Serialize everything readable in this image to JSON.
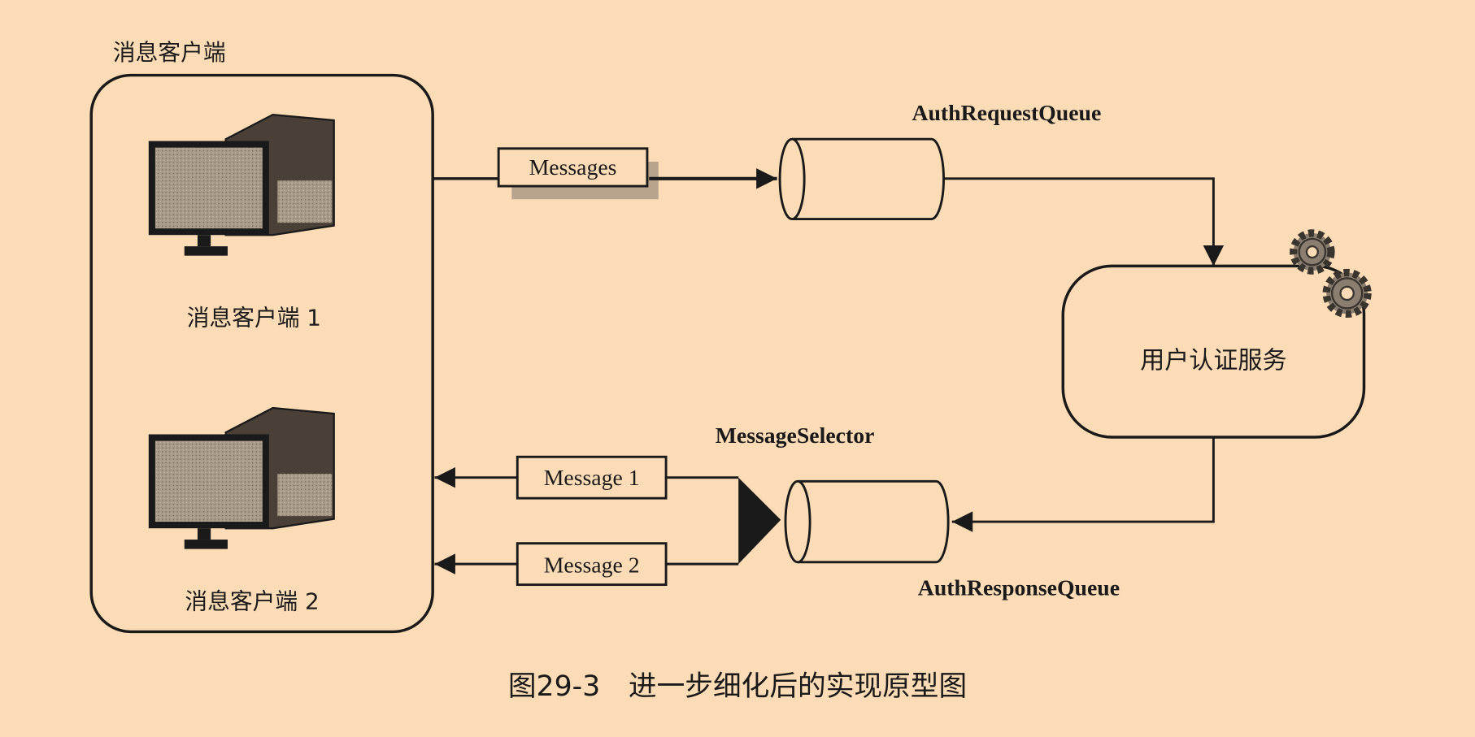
{
  "colors": {
    "background": "#fcdcb6",
    "ink": "#1a1a1a",
    "screen": "#a89a88",
    "tower_dark": "#4a4038"
  },
  "client_group": {
    "title": "消息客户端",
    "client1_label": "消息客户端 1",
    "client2_label": "消息客户端 2"
  },
  "request": {
    "message_label": "Messages",
    "queue_label": "AuthRequestQueue"
  },
  "service": {
    "label": "用户认证服务",
    "icon": "gears-icon"
  },
  "response": {
    "queue_label": "AuthResponseQueue",
    "selector_label": "MessageSelector",
    "message1_label": "Message 1",
    "message2_label": "Message 2"
  },
  "caption": "图29-3　进一步细化后的实现原型图"
}
